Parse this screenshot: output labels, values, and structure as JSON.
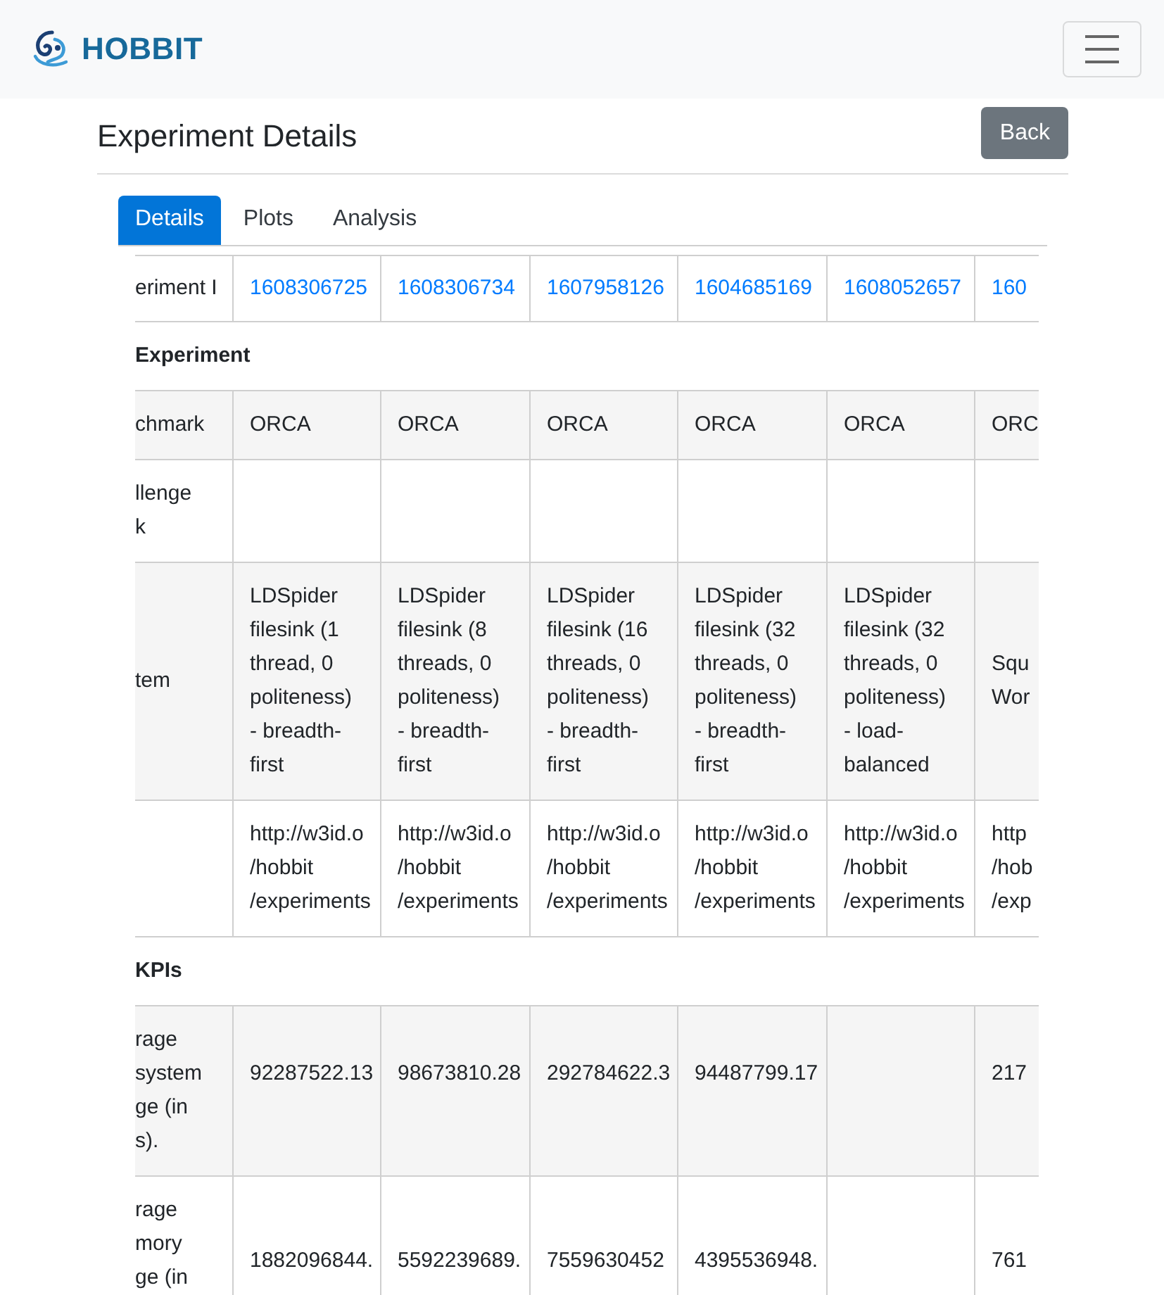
{
  "navbar": {
    "brand": "HOBBIT"
  },
  "header": {
    "title": "Experiment Details",
    "back_button": "Back"
  },
  "tabs": [
    {
      "label": "Details",
      "selected": true
    },
    {
      "label": "Plots",
      "selected": false
    },
    {
      "label": "Analysis",
      "selected": false
    }
  ],
  "table": {
    "id_row": {
      "label": "eriment I",
      "ids": [
        "1608306725",
        "1608306734",
        "1607958126",
        "1604685169",
        "1608052657",
        "160"
      ]
    },
    "sections": [
      {
        "title": "Experiment",
        "kind": "info",
        "rows": [
          {
            "label": "chmark",
            "cells": [
              "ORCA",
              "ORCA",
              "ORCA",
              "ORCA",
              "ORCA",
              "ORC"
            ]
          },
          {
            "label": "llenge\nk",
            "cells": [
              null,
              null,
              null,
              null,
              null,
              null
            ]
          },
          {
            "label": "tem",
            "cells": [
              "LDSpider\nfilesink (1\nthread, 0\npoliteness)\n- breadth-\nfirst",
              "LDSpider\nfilesink (8\nthreads, 0\npoliteness)\n- breadth-\nfirst",
              "LDSpider\nfilesink (16\nthreads, 0\npoliteness)\n- breadth-\nfirst",
              "LDSpider\nfilesink (32\nthreads, 0\npoliteness)\n- breadth-\nfirst",
              "LDSpider\nfilesink (32\nthreads, 0\npoliteness)\n- load-\nbalanced",
              "Squ\nWor"
            ]
          },
          {
            "cells": [
              "http://w3id.o\n/hobbit\n/experiments",
              "http://w3id.o\n/hobbit\n/experiments",
              "http://w3id.o\n/hobbit\n/experiments",
              "http://w3id.o\n/hobbit\n/experiments",
              "http://w3id.o\n/hobbit\n/experiments",
              "http\n/hob\n/exp"
            ]
          }
        ]
      },
      {
        "title": "KPIs",
        "kind": "kpi",
        "rows": [
          {
            "label": "rage\nsystem\nge (in\ns).",
            "cells": [
              "92287522.13",
              "98673810.28",
              "292784622.3",
              "94487799.17",
              null,
              "217"
            ]
          },
          {
            "label": "rage\nmory\nge (in",
            "cells": [
              "1882096844.",
              "5592239689.",
              "7559630452",
              "4395536948.",
              null,
              "761"
            ]
          }
        ]
      }
    ]
  }
}
